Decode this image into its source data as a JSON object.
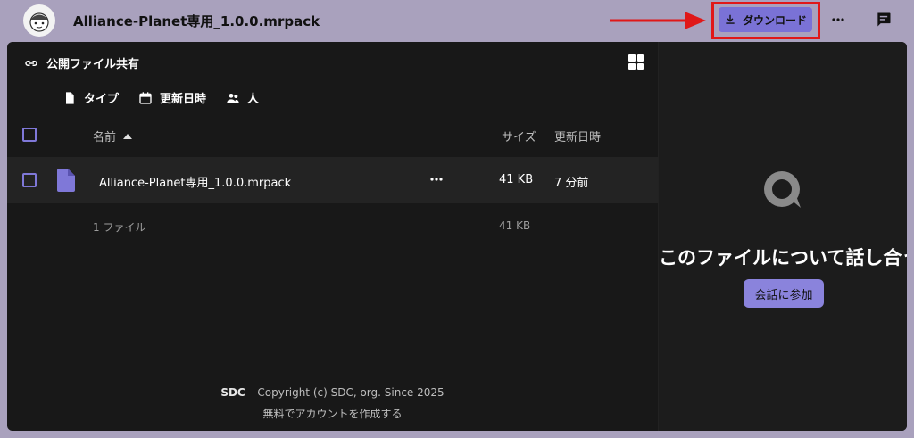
{
  "topbar": {
    "file_title": "Alliance-Planet専用_1.0.0.mrpack",
    "download_label": "ダウンロード",
    "accent": "#7a72d6",
    "highlight_color": "#e01818"
  },
  "share": {
    "title": "公開ファイル共有",
    "filters": [
      {
        "label": "タイプ",
        "icon": "document-icon"
      },
      {
        "label": "更新日時",
        "icon": "calendar-icon"
      },
      {
        "label": "人",
        "icon": "people-icon"
      }
    ]
  },
  "table": {
    "columns": {
      "name": "名前",
      "size": "サイズ",
      "date": "更新日時"
    },
    "rows": [
      {
        "name": "Alliance-Planet専用_1.0.0.mrpack",
        "size": "41 KB",
        "date": "7 分前"
      }
    ],
    "summary": {
      "count": "1 ファイル",
      "size": "41 KB"
    }
  },
  "footer": {
    "brand": "SDC",
    "copyright": " – Copyright (c) SDC, org. Since 2025",
    "create_account": "無料でアカウントを作成する"
  },
  "chat": {
    "title": "このファイルについて話し合う",
    "join_label": "会話に参加"
  }
}
